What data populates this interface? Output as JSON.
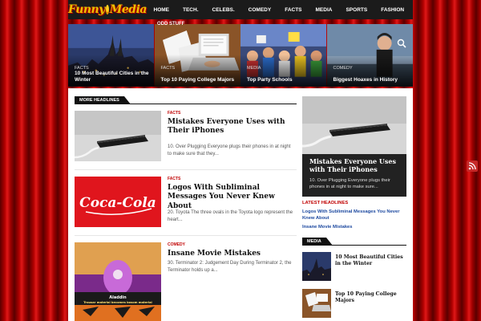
{
  "brand": {
    "logo_part1": "Funny",
    "logo_part2": "Media"
  },
  "nav": [
    "HOME",
    "TECH.",
    "CELEBS.",
    "COMEDY",
    "FACTS",
    "MEDIA",
    "SPORTS",
    "FASHION"
  ],
  "odd_stuff_label": "ODD STUFF",
  "featured": [
    {
      "category": "FACTS",
      "title": "10 Most Beautiful Cities in the Winter"
    },
    {
      "category": "FACTS",
      "title": "Top 10 Paying College Majors"
    },
    {
      "category": "MEDIA",
      "title": "Top Party Schools"
    },
    {
      "category": "COMEDY",
      "title": "Biggest Hoaxes in History"
    }
  ],
  "more_headlines_label": "MORE HEADLINES",
  "articles": [
    {
      "category": "FACTS",
      "title": "Mistakes Everyone Uses with Their iPhones",
      "excerpt": "10. Over Plugging Everyone plugs their phones in at night to make sure that they..."
    },
    {
      "category": "FACTS",
      "title": "Logos With Subliminal Messages You Never Knew About",
      "excerpt": "20. Toyota        The three ovals in the Toyota logo represent the heart..."
    },
    {
      "category": "COMEDY",
      "title": "Insane Movie Mistakes",
      "excerpt": "30. Terminator 2: Judgement Day     During Terminator 2, the Terminator holds up a..."
    }
  ],
  "coke_logo_text": "Coca-Cola",
  "aladdin_caption": "Aladdin",
  "aladdin_subcaption": "Trousar material becomes bosom material",
  "side_feature": {
    "title": "Mistakes Everyone Uses with Their iPhones",
    "excerpt": "10. Over Plugging Everyone plugs their phones in at night to make sure..."
  },
  "latest_headlines_label": "LATEST HEADLINES",
  "latest_links": [
    "Logos With Subliminal Messages You Never Knew About",
    "Insane Movie Mistakes"
  ],
  "media_label": "MEDIA",
  "media_items": [
    {
      "title": "10 Most Beautiful Cities in the Winter"
    },
    {
      "title": "Top 10 Paying College Majors"
    }
  ],
  "colors": {
    "accent_red": "#c00000",
    "link_blue": "#1e4aa0",
    "nav_bg": "#1b1b1b"
  },
  "icons": {
    "search": "search-icon",
    "rss": "rss-icon"
  }
}
